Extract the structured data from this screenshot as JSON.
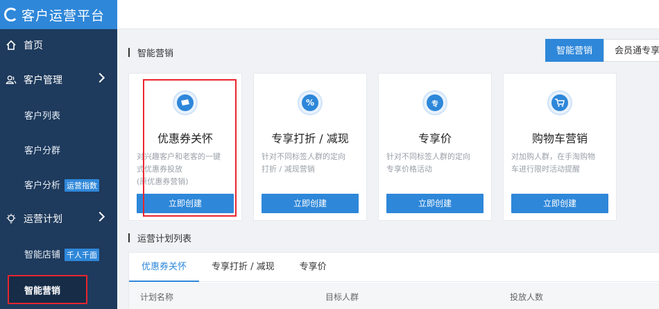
{
  "app": {
    "title": "客户运营平台"
  },
  "sidebar": {
    "items": [
      {
        "label": "首页",
        "icon": "home-icon"
      },
      {
        "label": "客户管理",
        "icon": "user-group-icon"
      },
      {
        "label": "运营计划",
        "icon": "bulb-icon"
      }
    ],
    "sub_customer": [
      {
        "label": "客户列表"
      },
      {
        "label": "客户分群"
      },
      {
        "label": "客户分析",
        "tag": "运营指数"
      }
    ],
    "sub_plan": [
      {
        "label": "智能店铺",
        "tag": "千人千面"
      },
      {
        "label": "智能营销"
      }
    ]
  },
  "section": {
    "title": "智能营销",
    "toggle": [
      "智能营销",
      "会员通专享"
    ]
  },
  "cards": [
    {
      "title": "优惠券关怀",
      "desc": [
        "对兴趣客户和老客的一键",
        "式优惠券投放",
        "(原优惠券营销)"
      ],
      "button": "立即创建",
      "icon": "ticket-icon"
    },
    {
      "title": "专享打折 / 减现",
      "desc": [
        "针对不同标签人群的定向",
        "打折 / 减现营销"
      ],
      "button": "立即创建",
      "icon": "percent-icon"
    },
    {
      "title": "专享价",
      "desc": [
        "针对不同标签人群的定向",
        "专享价格活动"
      ],
      "button": "立即创建",
      "icon": "exclusive-icon",
      "icon_text": "专"
    },
    {
      "title": "购物车营销",
      "desc": [
        "对加购人群，在手淘购物",
        "车进行限时活动提醒"
      ],
      "button": "立即创建",
      "icon": "cart-icon"
    }
  ],
  "plan_list": {
    "title": "运营计划列表",
    "tabs": [
      "优惠券关怀",
      "专享打折 / 减现",
      "专享价"
    ],
    "columns": [
      "计划名称",
      "目标人群",
      "投放人数"
    ]
  },
  "colors": {
    "accent": "#2e87d9",
    "sidebar": "#1e3a5c",
    "highlight": "#e8262f"
  }
}
